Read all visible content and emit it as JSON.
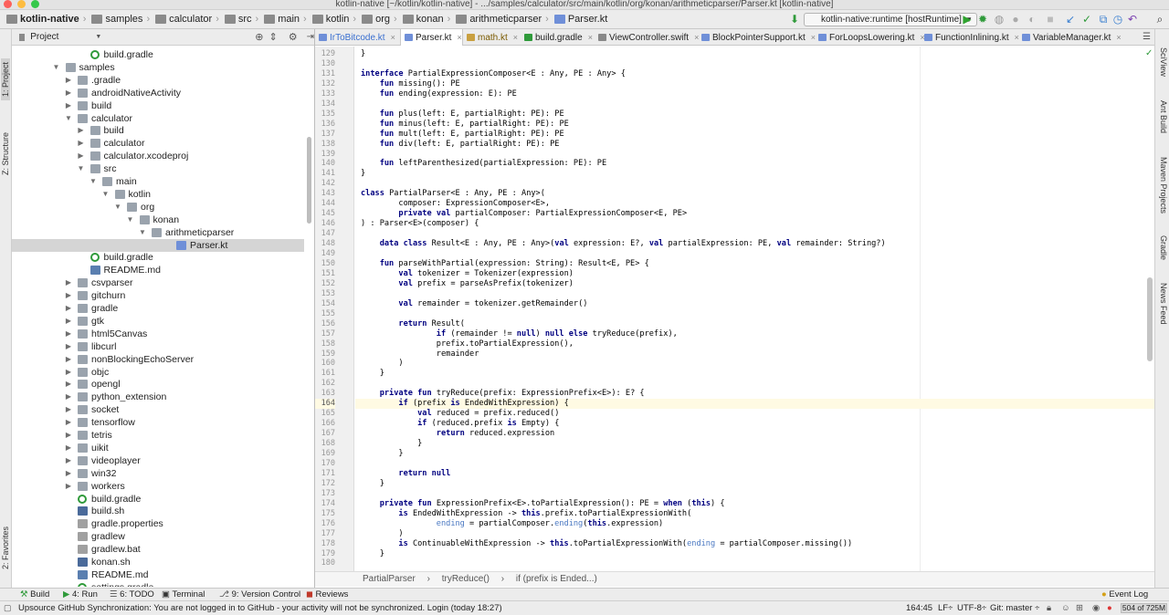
{
  "window": {
    "title": "kotlin-native [~/kotlin/kotlin-native] - .../samples/calculator/src/main/kotlin/org/konan/arithmeticparser/Parser.kt [kotlin-native]"
  },
  "breadcrumbs": [
    "kotlin-native",
    "samples",
    "calculator",
    "src",
    "main",
    "kotlin",
    "org",
    "konan",
    "arithmeticparser",
    "Parser.kt"
  ],
  "run_config": "kotlin-native:runtime [hostRuntime]",
  "left_strip": {
    "project": "1: Project",
    "structure": "Z: Structure",
    "favorites": "2: Favorites"
  },
  "right_strip": {
    "sciview": "SciView",
    "ant": "Ant Build",
    "maven": "Maven Projects",
    "gradle": "Gradle",
    "news": "News Feed"
  },
  "project_panel": {
    "title": "Project"
  },
  "tree": [
    {
      "label": "build.gradle",
      "indent": 3,
      "icon": "gradle",
      "arrow": ""
    },
    {
      "label": "samples",
      "indent": 1,
      "icon": "folder",
      "arrow": "down"
    },
    {
      "label": ".gradle",
      "indent": 2,
      "icon": "folder",
      "arrow": "right"
    },
    {
      "label": "androidNativeActivity",
      "indent": 2,
      "icon": "folder",
      "arrow": "right"
    },
    {
      "label": "build",
      "indent": 2,
      "icon": "folder",
      "arrow": "right"
    },
    {
      "label": "calculator",
      "indent": 2,
      "icon": "folder",
      "arrow": "down"
    },
    {
      "label": "build",
      "indent": 3,
      "icon": "folder",
      "arrow": "right"
    },
    {
      "label": "calculator",
      "indent": 3,
      "icon": "folder",
      "arrow": "right"
    },
    {
      "label": "calculator.xcodeproj",
      "indent": 3,
      "icon": "folder",
      "arrow": "right"
    },
    {
      "label": "src",
      "indent": 3,
      "icon": "folder",
      "arrow": "down"
    },
    {
      "label": "main",
      "indent": 4,
      "icon": "folder",
      "arrow": "down"
    },
    {
      "label": "kotlin",
      "indent": 5,
      "icon": "folder",
      "arrow": "down"
    },
    {
      "label": "org",
      "indent": 6,
      "icon": "folder",
      "arrow": "down"
    },
    {
      "label": "konan",
      "indent": 7,
      "icon": "folder",
      "arrow": "down"
    },
    {
      "label": "arithmeticparser",
      "indent": 8,
      "icon": "folder",
      "arrow": "down"
    },
    {
      "label": "Parser.kt",
      "indent": 10,
      "icon": "kt",
      "arrow": "",
      "selected": true
    },
    {
      "label": "build.gradle",
      "indent": 3,
      "icon": "gradle",
      "arrow": ""
    },
    {
      "label": "README.md",
      "indent": 3,
      "icon": "md",
      "arrow": ""
    },
    {
      "label": "csvparser",
      "indent": 2,
      "icon": "folder",
      "arrow": "right"
    },
    {
      "label": "gitchurn",
      "indent": 2,
      "icon": "folder",
      "arrow": "right"
    },
    {
      "label": "gradle",
      "indent": 2,
      "icon": "folder",
      "arrow": "right"
    },
    {
      "label": "gtk",
      "indent": 2,
      "icon": "folder",
      "arrow": "right"
    },
    {
      "label": "html5Canvas",
      "indent": 2,
      "icon": "folder",
      "arrow": "right"
    },
    {
      "label": "libcurl",
      "indent": 2,
      "icon": "folder",
      "arrow": "right"
    },
    {
      "label": "nonBlockingEchoServer",
      "indent": 2,
      "icon": "folder",
      "arrow": "right"
    },
    {
      "label": "objc",
      "indent": 2,
      "icon": "folder",
      "arrow": "right"
    },
    {
      "label": "opengl",
      "indent": 2,
      "icon": "folder",
      "arrow": "right"
    },
    {
      "label": "python_extension",
      "indent": 2,
      "icon": "folder",
      "arrow": "right"
    },
    {
      "label": "socket",
      "indent": 2,
      "icon": "folder",
      "arrow": "right"
    },
    {
      "label": "tensorflow",
      "indent": 2,
      "icon": "folder",
      "arrow": "right"
    },
    {
      "label": "tetris",
      "indent": 2,
      "icon": "folder",
      "arrow": "right"
    },
    {
      "label": "uikit",
      "indent": 2,
      "icon": "folder",
      "arrow": "right"
    },
    {
      "label": "videoplayer",
      "indent": 2,
      "icon": "folder",
      "arrow": "right"
    },
    {
      "label": "win32",
      "indent": 2,
      "icon": "folder",
      "arrow": "right"
    },
    {
      "label": "workers",
      "indent": 2,
      "icon": "folder",
      "arrow": "right"
    },
    {
      "label": "build.gradle",
      "indent": 2,
      "icon": "gradle",
      "arrow": ""
    },
    {
      "label": "build.sh",
      "indent": 2,
      "icon": "sh",
      "arrow": ""
    },
    {
      "label": "gradle.properties",
      "indent": 2,
      "icon": "prop",
      "arrow": ""
    },
    {
      "label": "gradlew",
      "indent": 2,
      "icon": "prop",
      "arrow": ""
    },
    {
      "label": "gradlew.bat",
      "indent": 2,
      "icon": "prop",
      "arrow": ""
    },
    {
      "label": "konan.sh",
      "indent": 2,
      "icon": "sh",
      "arrow": ""
    },
    {
      "label": "README.md",
      "indent": 2,
      "icon": "md",
      "arrow": ""
    },
    {
      "label": "settings.gradle",
      "indent": 2,
      "icon": "gradle",
      "arrow": ""
    }
  ],
  "tabs": [
    {
      "label": "IrToBitcode.kt",
      "color": "#6f8fd8"
    },
    {
      "label": "Parser.kt",
      "color": "#6f8fd8",
      "active": true
    },
    {
      "label": "math.kt",
      "color": "#c9a040"
    },
    {
      "label": "build.gradle",
      "color": "#2f9a3a"
    },
    {
      "label": "ViewController.swift",
      "color": "#888888"
    },
    {
      "label": "BlockPointerSupport.kt",
      "color": "#6f8fd8"
    },
    {
      "label": "ForLoopsLowering.kt",
      "color": "#6f8fd8"
    },
    {
      "label": "FunctionInlining.kt",
      "color": "#6f8fd8"
    },
    {
      "label": "VariableManager.kt",
      "color": "#6f8fd8"
    }
  ],
  "code_start_line": 129,
  "current_line": 164,
  "code_lines": [
    "}",
    "",
    "interface PartialExpressionComposer<E : Any, PE : Any> {",
    "    fun missing(): PE",
    "    fun ending(expression: E): PE",
    "",
    "    fun plus(left: E, partialRight: PE): PE",
    "    fun minus(left: E, partialRight: PE): PE",
    "    fun mult(left: E, partialRight: PE): PE",
    "    fun div(left: E, partialRight: PE): PE",
    "",
    "    fun leftParenthesized(partialExpression: PE): PE",
    "}",
    "",
    "class PartialParser<E : Any, PE : Any>(",
    "        composer: ExpressionComposer<E>,",
    "        private val partialComposer: PartialExpressionComposer<E, PE>",
    ") : Parser<E>(composer) {",
    "",
    "    data class Result<E : Any, PE : Any>(val expression: E?, val partialExpression: PE, val remainder: String?)",
    "",
    "    fun parseWithPartial(expression: String): Result<E, PE> {",
    "        val tokenizer = Tokenizer(expression)",
    "        val prefix = parseAsPrefix(tokenizer)",
    "",
    "        val remainder = tokenizer.getRemainder()",
    "",
    "        return Result(",
    "                if (remainder != null) null else tryReduce(prefix),",
    "                prefix.toPartialExpression(),",
    "                remainder",
    "        )",
    "    }",
    "",
    "    private fun tryReduce(prefix: ExpressionPrefix<E>): E? {",
    "        if (prefix is EndedWithExpression) {",
    "            val reduced = prefix.reduced()",
    "            if (reduced.prefix is Empty) {",
    "                return reduced.expression",
    "            }",
    "        }",
    "",
    "        return null",
    "    }",
    "",
    "    private fun ExpressionPrefix<E>.toPartialExpression(): PE = when (this) {",
    "        is EndedWithExpression -> this.prefix.toPartialExpressionWith(",
    "                ending = partialComposer.ending(this.expression)",
    "        )",
    "        is ContinuableWithExpression -> this.toPartialExpressionWith(ending = partialComposer.missing())",
    "    }",
    ""
  ],
  "editor_breadcrumb": [
    "PartialParser",
    "tryReduce()",
    "if (prefix is Ended...)"
  ],
  "tool_windows": {
    "build": "Build",
    "run": "4: Run",
    "todo": "6: TODO",
    "terminal": "Terminal",
    "vcs": "9: Version Control",
    "reviews": "Reviews",
    "event_log": "Event Log"
  },
  "status": {
    "message": "Upsource GitHub Synchronization: You are not logged in to GitHub - your activity will not be synchronized. Login (today 18:27)",
    "position": "164:45",
    "line_sep": "LF÷",
    "encoding": "UTF-8÷",
    "git": "Git: master ÷",
    "memory": "504 of 725M"
  },
  "keywords": [
    "interface",
    "fun",
    "class",
    "private",
    "val",
    "data",
    "return",
    "if",
    "null",
    "else",
    "is",
    "when",
    "this"
  ],
  "colors": {
    "keyword": "#000080",
    "param": "#4a78c2",
    "selection": "#d5d5d5",
    "current_line": "#fffae3"
  }
}
